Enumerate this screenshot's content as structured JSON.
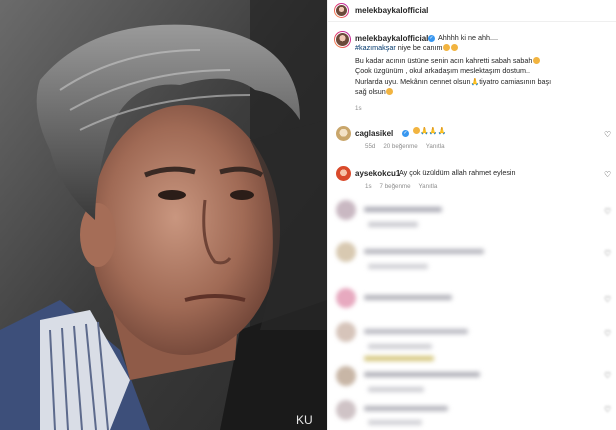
{
  "post": {
    "author": "melekbaykalofficial",
    "caption": {
      "author": "melekbaykalofficial",
      "line1": "Ahhhh ki ne ahh....",
      "hashtag": "#kazımakşar",
      "line2_rest": " niye be canım",
      "line3": "Bu kadar acının üstüne senin acın kahretti sabah sabah",
      "line4": "Çook üzgünüm , okul arkadaşım meslektaşım dostum..",
      "line5_a": "Nurlarda uyu. Mekânın cennet olsun",
      "line5_b": "tiyatro camiasının başı",
      "line6": "sağ olsun",
      "time": "1s"
    },
    "comments": [
      {
        "user": "caglasikel",
        "text": "",
        "time": "55d",
        "likes": "20 beğenme",
        "reply": "Yanıtla"
      },
      {
        "user": "aysekokcu1",
        "text": "Ay çok üzüldüm allah rahmet eylesin",
        "time": "1s",
        "likes": "7 beğenme",
        "reply": "Yanıtla"
      }
    ]
  },
  "photo": {
    "watermark": "KU"
  },
  "colors": {
    "verified": "#3897f0",
    "hashtag": "#00376b",
    "meta": "#8e8e8e"
  },
  "icons": {
    "like": "heart-outline-icon",
    "verified": "verified-badge-icon"
  }
}
